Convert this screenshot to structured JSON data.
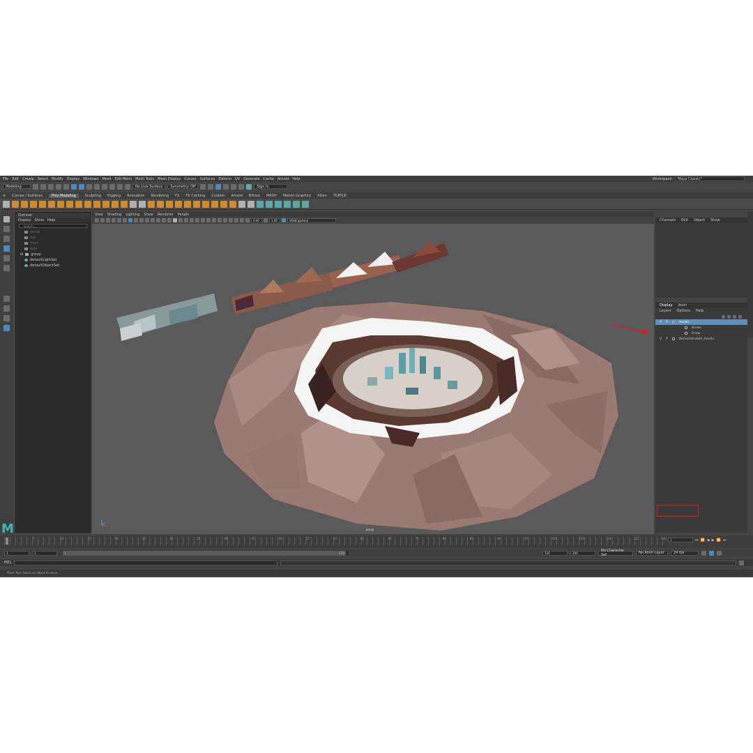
{
  "menubar": {
    "items": [
      "File",
      "Edit",
      "Create",
      "Select",
      "Modify",
      "Display",
      "Windows",
      "Mesh",
      "Edit Mesh",
      "Mesh Tools",
      "Mesh Display",
      "Curves",
      "Surfaces",
      "Deform",
      "UV",
      "Generate",
      "Cache",
      "Arnold",
      "Help"
    ],
    "workspace_label": "Workspace:",
    "workspace_value": "Maya Classic*"
  },
  "statusline": {
    "mode": "Modeling",
    "live_surface": "No Live Surface",
    "symmetry": "Symmetry: Off",
    "sign_in": "Sign In"
  },
  "shelf_tabs": [
    "Curves / Surfaces",
    "Poly Modeling",
    "Sculpting",
    "Rigging",
    "Animation",
    "Rendering",
    "FX",
    "FX Caching",
    "Custom",
    "Arnold",
    "Bifrost",
    "MASH",
    "Motion Graphics",
    "XGen",
    "TURTLE"
  ],
  "shelf_active": "Poly Modeling",
  "outliner": {
    "title": "Outliner",
    "menu": [
      "Display",
      "Show",
      "Help"
    ],
    "search_placeholder": "Search...",
    "items": [
      "persp",
      "top",
      "front",
      "side",
      "group",
      "defaultLightSet",
      "defaultObjectSet"
    ]
  },
  "viewport": {
    "menu": [
      "View",
      "Shading",
      "Lighting",
      "Show",
      "Renderer",
      "Panels"
    ],
    "field_a": "0.00",
    "field_b": "1.00",
    "color_space": "sRGB gamma",
    "camera_label": "persp"
  },
  "channel_box": {
    "menu": [
      "Channels",
      "Edit",
      "Object",
      "Show"
    ]
  },
  "layer_editor": {
    "tabs": [
      "Display",
      "Anim"
    ],
    "menu": [
      "Layers",
      "Options",
      "Help"
    ],
    "layers": [
      {
        "v": "V",
        "p": "P",
        "name": "Assets"
      },
      {
        "v": "",
        "p": "",
        "name": "Brown"
      },
      {
        "v": "",
        "p": "",
        "name": "Snow"
      },
      {
        "v": "V",
        "p": "P",
        "name": "Demonstration_Assets"
      }
    ]
  },
  "timeline": {
    "ticks": [
      "1",
      "5",
      "10",
      "15",
      "20",
      "25",
      "30",
      "35",
      "40",
      "45",
      "50",
      "55",
      "60",
      "65",
      "70",
      "75",
      "80",
      "85",
      "90",
      "95",
      "100",
      "105",
      "110",
      "115",
      "120"
    ],
    "current_frame": "1"
  },
  "range": {
    "start": "1",
    "start_inner": "1",
    "slider_start": "1",
    "slider_end": "120",
    "end_inner": "120",
    "end": "200",
    "character_set": "No Character Set",
    "anim_layer": "No Anim Layer",
    "fps": "24 fps"
  },
  "mel_label": "MEL",
  "help_line": "Move Tool: Select an object to move."
}
